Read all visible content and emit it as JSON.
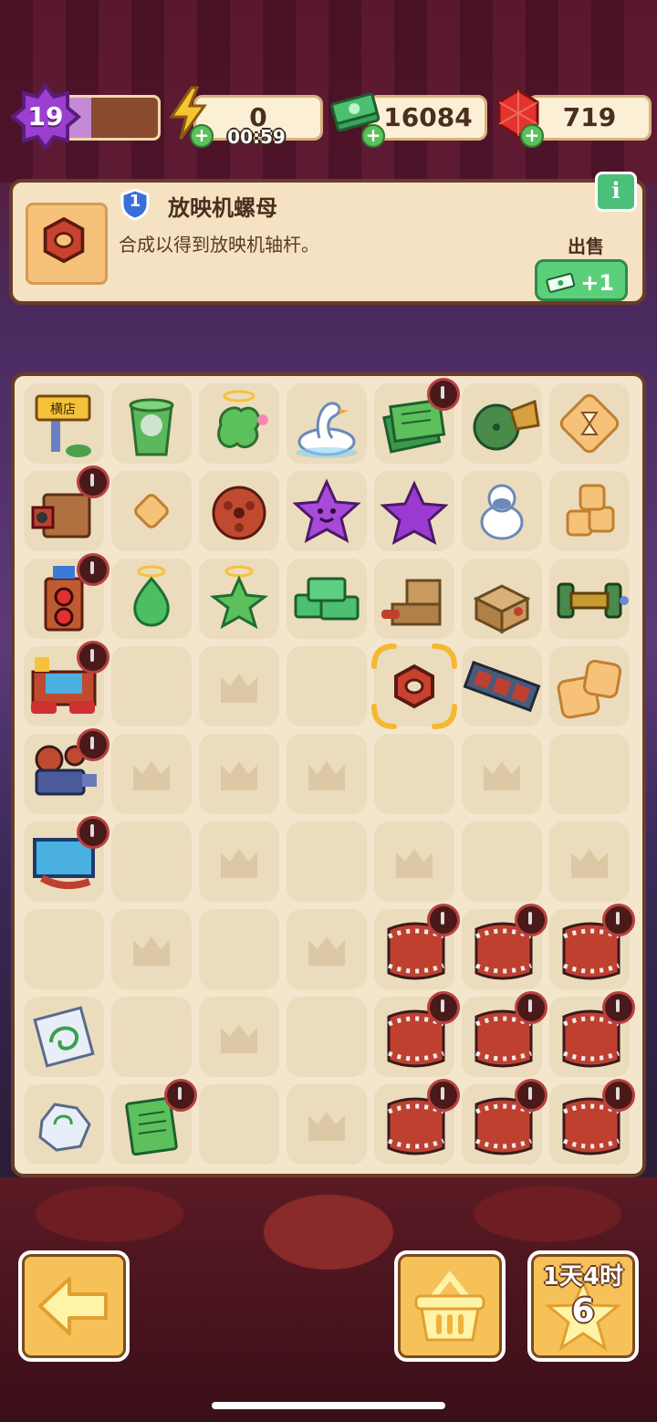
{
  "topbar": {
    "level": "19",
    "xp_progress": 0.3,
    "energy": "0",
    "energy_timer": "00:59",
    "cash": "16084",
    "gems": "719"
  },
  "info_panel": {
    "item_level": "1",
    "item_name": "放映机螺母",
    "item_desc": "合成以得到放映机轴杆。",
    "sell_label": "出售",
    "sell_value": "+1",
    "info_glyph": "i"
  },
  "board": {
    "rows": 9,
    "cols": 7,
    "grid": [
      [
        "shop-sign",
        "trash-bin",
        "angel-green-blob",
        "swan",
        "green-documents",
        "green-film-reel-head",
        "hourglass-tile"
      ],
      [
        "vintage-camera",
        "small-bread",
        "film-reel-red",
        "purple-smiley-star",
        "purple-star",
        "white-duck",
        "bread-stack"
      ],
      [
        "arcade-speaker",
        "angel-green-drop",
        "angel-green-star",
        "cash-stack",
        "cardboard-projector",
        "cardboard-box-projector",
        "dumbbell"
      ],
      [
        "cinema-snack-bar",
        "empty",
        "ghost",
        "empty",
        "projector-nut",
        "film-strip",
        "bread-pair"
      ],
      [
        "film-projector",
        "ghost",
        "ghost",
        "ghost",
        "empty",
        "ghost",
        "empty"
      ],
      [
        "cinema-screen",
        "empty",
        "ghost",
        "empty",
        "ghost",
        "empty",
        "ghost"
      ],
      [
        "empty",
        "ghost",
        "empty",
        "ghost",
        "film-roll",
        "film-roll",
        "film-roll"
      ],
      [
        "paper-sketch",
        "empty",
        "ghost",
        "empty",
        "film-roll",
        "film-roll",
        "film-roll"
      ],
      [
        "crumpled-paper",
        "green-notebook",
        "empty",
        "ghost",
        "film-roll",
        "film-roll",
        "film-roll"
      ]
    ],
    "locked_badges": [
      [
        0,
        4
      ],
      [
        1,
        0
      ],
      [
        2,
        0
      ],
      [
        3,
        0
      ],
      [
        4,
        0
      ],
      [
        5,
        0
      ],
      [
        8,
        1
      ],
      [
        6,
        4
      ],
      [
        6,
        5
      ],
      [
        6,
        6
      ],
      [
        7,
        4
      ],
      [
        7,
        5
      ],
      [
        7,
        6
      ],
      [
        8,
        4
      ],
      [
        8,
        5
      ],
      [
        8,
        6
      ]
    ],
    "selected": [
      3,
      4
    ]
  },
  "bottom": {
    "back_icon": "arrow-left-icon",
    "basket_icon": "basket-icon",
    "quest_time": "1天4时",
    "quest_count": "6"
  },
  "colors": {
    "board_bg": "#f4e6cc",
    "cell_bg": "#ecdcbe",
    "button_yellow": "#f7c15a",
    "sell_green": "#5ccf7a"
  }
}
